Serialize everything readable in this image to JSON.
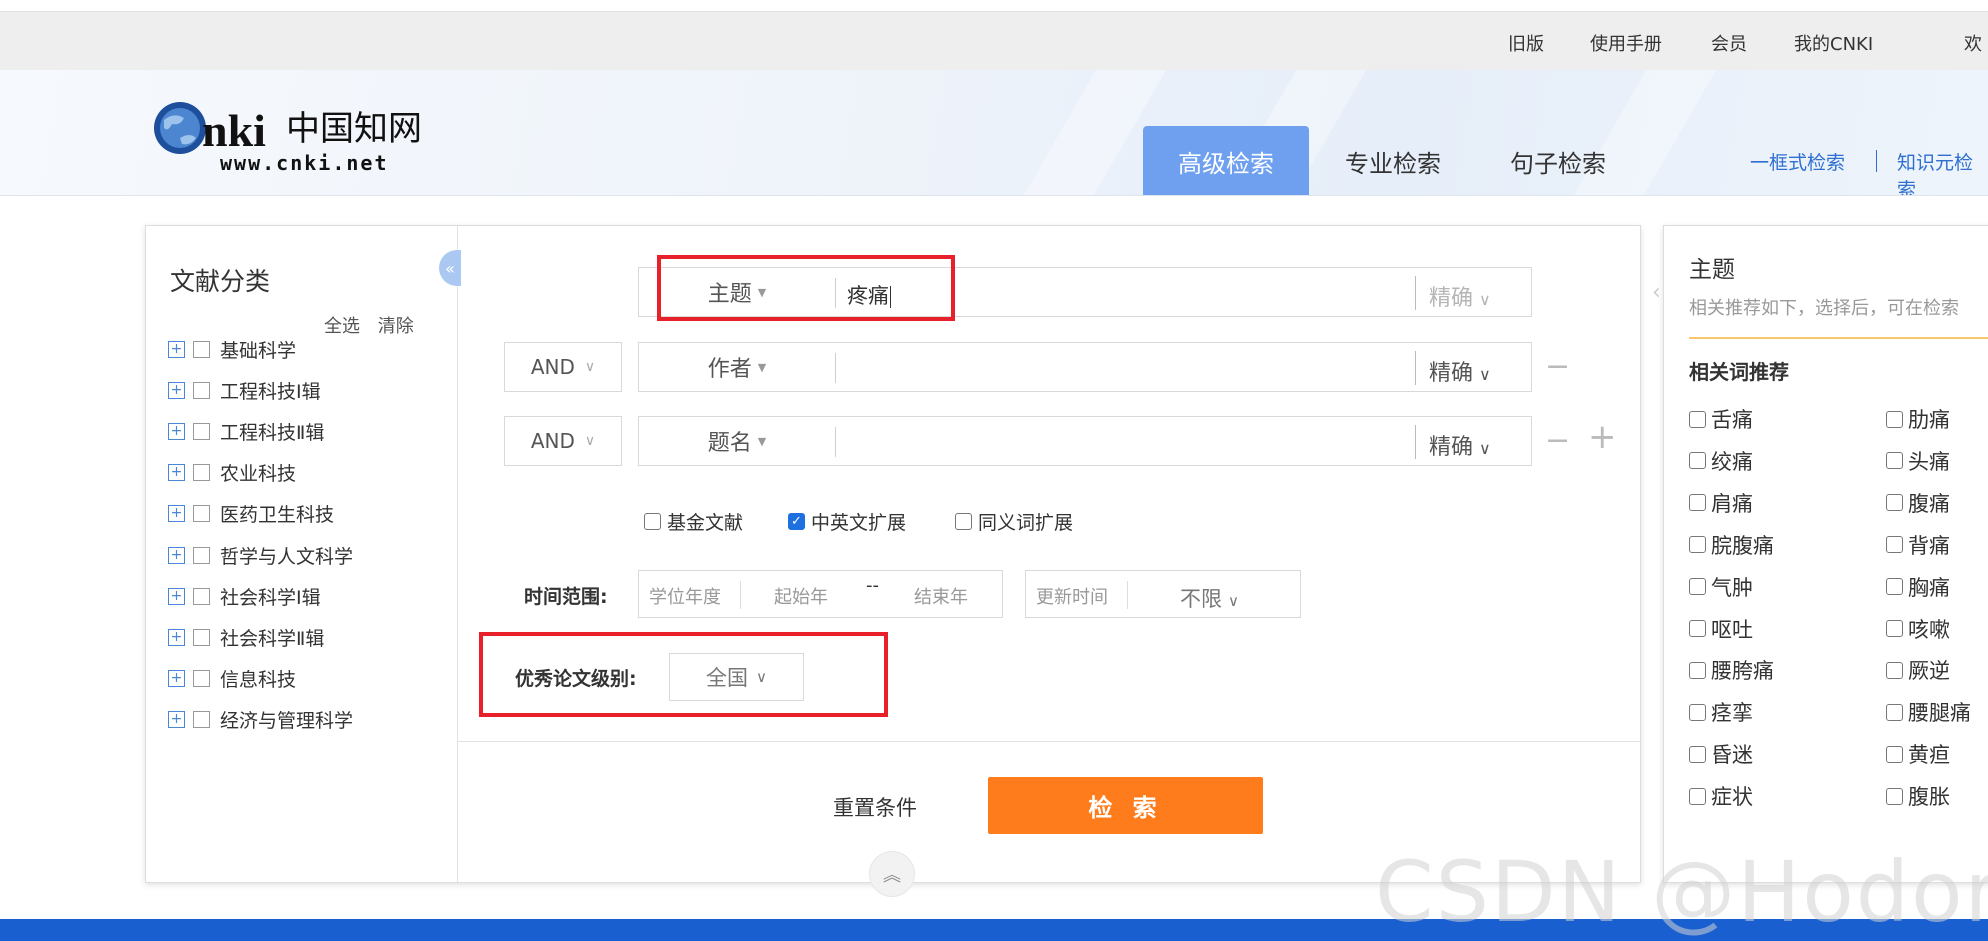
{
  "topbar": {
    "links": [
      "旧版",
      "使用手册",
      "会员",
      "我的CNKI",
      "欢"
    ]
  },
  "logo": {
    "text_main": "CNKI中国知网",
    "url_text": "www.cnki.net"
  },
  "header": {
    "tabs": [
      "高级检索",
      "专业检索",
      "句子检索"
    ],
    "active_tab": "高级检索",
    "links": [
      "一框式检索",
      "知识元检索"
    ]
  },
  "sidebar": {
    "title": "文献分类",
    "select_all": "全选",
    "clear": "清除",
    "collapse_icon": "«",
    "categories": [
      "基础科学",
      "工程科技Ⅰ辑",
      "工程科技Ⅱ辑",
      "农业科技",
      "医药卫生科技",
      "哲学与人文科学",
      "社会科学Ⅰ辑",
      "社会科学Ⅱ辑",
      "信息科技",
      "经济与管理科学"
    ]
  },
  "form": {
    "rows": [
      {
        "operator": "",
        "field": "主题",
        "value": "疼痛",
        "match": "精确"
      },
      {
        "operator": "AND",
        "field": "作者",
        "value": "",
        "match": "精确"
      },
      {
        "operator": "AND",
        "field": "题名",
        "value": "",
        "match": "精确"
      }
    ],
    "minus": "−",
    "plus": "+",
    "options": [
      {
        "label": "基金文献",
        "checked": false
      },
      {
        "label": "中英文扩展",
        "checked": true
      },
      {
        "label": "同义词扩展",
        "checked": false
      }
    ],
    "time_label": "时间范围:",
    "degree_year": "学位年度",
    "start_year": "起始年",
    "range_sep": "--",
    "end_year": "结束年",
    "update_time": "更新时间",
    "update_value": "不限",
    "level_label": "优秀论文级别:",
    "level_value": "全国",
    "reset": "重置条件",
    "search": "检 索",
    "collapse_up": "︽"
  },
  "rpanel": {
    "title": "主题",
    "subtitle": "相关推荐如下，选择后，可在检索",
    "heading": "相关词推荐",
    "col1": [
      "舌痛",
      "绞痛",
      "肩痛",
      "脘腹痛",
      "气肿",
      "呕吐",
      "腰胯痛",
      "痉挛",
      "昏迷",
      "症状"
    ],
    "col2": [
      "肋痛",
      "头痛",
      "腹痛",
      "背痛",
      "胸痛",
      "咳嗽",
      "厥逆",
      "腰腿痛",
      "黄疸",
      "腹胀"
    ]
  },
  "watermark": "CSDN @Hodors",
  "colors": {
    "accent": "#6ea0ef",
    "search_button": "#fe7c1b",
    "highlight": "#e8202a",
    "link": "#2f6fd0"
  }
}
